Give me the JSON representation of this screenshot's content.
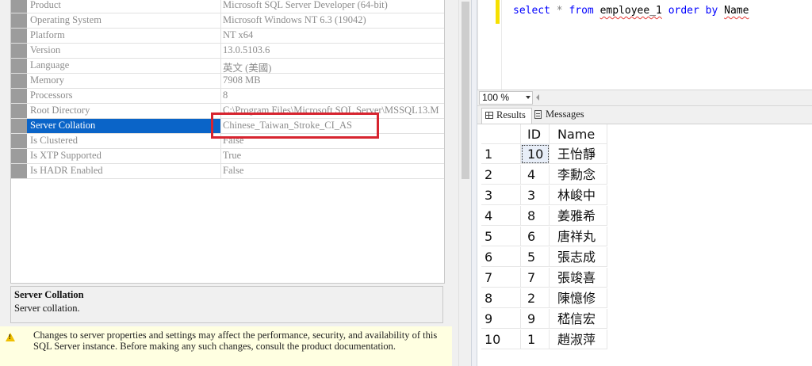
{
  "properties": {
    "rows": [
      {
        "name": "Product",
        "value": "Microsoft SQL Server Developer (64-bit)"
      },
      {
        "name": "Operating System",
        "value": "Microsoft Windows NT 6.3 (19042)"
      },
      {
        "name": "Platform",
        "value": "NT x64"
      },
      {
        "name": "Version",
        "value": "13.0.5103.6"
      },
      {
        "name": "Language",
        "value": "英文 (美國)"
      },
      {
        "name": "Memory",
        "value": "7908 MB"
      },
      {
        "name": "Processors",
        "value": "8"
      },
      {
        "name": "Root Directory",
        "value": "C:\\Program Files\\Microsoft SQL Server\\MSSQL13.M"
      },
      {
        "name": "Server Collation",
        "value": "Chinese_Taiwan_Stroke_CI_AS"
      },
      {
        "name": "Is Clustered",
        "value": "False"
      },
      {
        "name": "Is XTP Supported",
        "value": "True"
      },
      {
        "name": "Is HADR Enabled",
        "value": "False"
      }
    ],
    "selected_row": "Server Collation"
  },
  "description": {
    "title": "Server Collation",
    "text": "Server collation."
  },
  "warning": {
    "icon": "warning-icon",
    "text": "Changes to server properties and settings may affect the performance, security, and availability of this SQL Server instance. Before making any such changes, consult the product documentation."
  },
  "editor": {
    "sql_tokens": {
      "select": "select",
      "star": "*",
      "from": "from",
      "table": "employee_1",
      "order": "order",
      "by": "by",
      "column": "Name"
    }
  },
  "zoom": {
    "value": "100 %"
  },
  "tabs": {
    "results": "Results",
    "messages": "Messages"
  },
  "results": {
    "columns": [
      "ID",
      "Name"
    ],
    "rows": [
      {
        "n": "1",
        "id": "10",
        "name": "王怡靜"
      },
      {
        "n": "2",
        "id": "4",
        "name": "李勳念"
      },
      {
        "n": "3",
        "id": "3",
        "name": "林峻中"
      },
      {
        "n": "4",
        "id": "8",
        "name": "姜雅希"
      },
      {
        "n": "5",
        "id": "6",
        "name": "唐祥丸"
      },
      {
        "n": "6",
        "id": "5",
        "name": "張志成"
      },
      {
        "n": "7",
        "id": "7",
        "name": "張竣喜"
      },
      {
        "n": "8",
        "id": "2",
        "name": "陳憶修"
      },
      {
        "n": "9",
        "id": "9",
        "name": "嵇信宏"
      },
      {
        "n": "10",
        "id": "1",
        "name": "趙淑萍"
      }
    ]
  },
  "colors": {
    "selection": "#0a64c8",
    "highlight_box": "#d7242f",
    "keyword": "#0000ff",
    "warning_bg": "#ffffe1"
  }
}
